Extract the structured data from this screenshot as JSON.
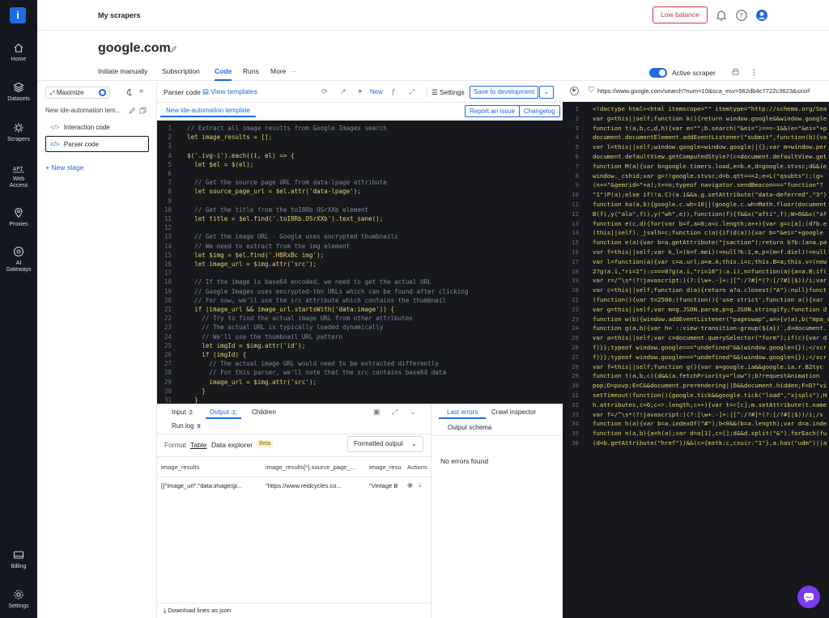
{
  "topbar": {
    "title": "My scrapers",
    "low_balance": "Low balance"
  },
  "nav": [
    {
      "label": "Home",
      "icon": "home-icon"
    },
    {
      "label": "Datasets",
      "icon": "datasets-icon"
    },
    {
      "label": "Scrapers",
      "icon": "scrapers-icon"
    },
    {
      "label": "Web Access",
      "icon": "web-access-icon"
    },
    {
      "label": "Proxies",
      "icon": "proxies-icon"
    },
    {
      "label": "AI Gateways",
      "icon": "ai-gateways-icon"
    },
    {
      "label": "Billing",
      "icon": "billing-icon"
    },
    {
      "label": "Settings",
      "icon": "settings-icon"
    }
  ],
  "header": {
    "site": "google.com",
    "tabs": [
      "Initiate manually",
      "Subscription",
      "Code",
      "Runs",
      "More"
    ],
    "active_tab": "Code",
    "active_scraper": "Active scraper"
  },
  "stages": {
    "maximize": "Maximize",
    "template": "New ide-automation tem...",
    "items": [
      "Interaction code",
      "Parser code"
    ],
    "new_stage": "+ New stage"
  },
  "editor": {
    "label": "Parser code",
    "view_templates": "View templates",
    "new_label": "New",
    "settings": "Settings",
    "save": "Save to development",
    "subtab": "New ide-automation template",
    "report": "Report an issue",
    "changelog": "Changelog",
    "lines": [
      {
        "n": "1",
        "t": "// Extract all image results from Google Images search",
        "c": true
      },
      {
        "n": "2",
        "t": "let image_results = [];",
        "c": false
      },
      {
        "n": "3",
        "t": "",
        "c": false
      },
      {
        "n": "4",
        "t": "$('.ivg-i').each((i, el) => {",
        "c": false
      },
      {
        "n": "5",
        "t": "  let $el = $(el);",
        "c": false
      },
      {
        "n": "6",
        "t": "",
        "c": false
      },
      {
        "n": "7",
        "t": "  // Get the source page URL from data-lpage attribute",
        "c": true
      },
      {
        "n": "8",
        "t": "  let source_page_url = $el.attr('data-lpage');",
        "c": false
      },
      {
        "n": "9",
        "t": "",
        "c": false
      },
      {
        "n": "10",
        "t": "  // Get the title from the toI8Rb OSrXXb element",
        "c": true
      },
      {
        "n": "11",
        "t": "  let title = $el.find('.toI8Rb.OSrXXb').text_sane();",
        "c": false
      },
      {
        "n": "12",
        "t": "",
        "c": false
      },
      {
        "n": "13",
        "t": "  // Get the image URL - Google uses encrypted thumbnails",
        "c": true
      },
      {
        "n": "14",
        "t": "  // We need to extract from the img element",
        "c": true
      },
      {
        "n": "15",
        "t": "  let $img = $el.find('.H8RxBc img');",
        "c": false
      },
      {
        "n": "16",
        "t": "  let image_url = $img.attr('src');",
        "c": false
      },
      {
        "n": "17",
        "t": "",
        "c": false
      },
      {
        "n": "18",
        "t": "  // If the image is base64 encoded, we need to get the actual URL",
        "c": true
      },
      {
        "n": "19",
        "t": "  // Google Images uses encrypted-tbn URLs which can be found after clicking",
        "c": true
      },
      {
        "n": "20",
        "t": "  // For now, we'll use the src attribute which contains the thumbnail",
        "c": true
      },
      {
        "n": "21",
        "t": "  if (image_url && image_url.startsWith('data:image')) {",
        "c": false
      },
      {
        "n": "22",
        "t": "    // Try to find the actual image URL from other attributes",
        "c": true
      },
      {
        "n": "23",
        "t": "    // The actual URL is typically loaded dynamically",
        "c": true
      },
      {
        "n": "24",
        "t": "    // We'll use the thumbnail URL pattern",
        "c": true
      },
      {
        "n": "25",
        "t": "    let imgId = $img.attr('id');",
        "c": false
      },
      {
        "n": "26",
        "t": "    if (imgId) {",
        "c": false
      },
      {
        "n": "27",
        "t": "      // The actual image URL would need to be extracted differently",
        "c": true
      },
      {
        "n": "28",
        "t": "      // For this parser, we'll note that the src contains base64 data",
        "c": true
      },
      {
        "n": "29",
        "t": "      image_url = $img.attr('src');",
        "c": false
      },
      {
        "n": "30",
        "t": "    }",
        "c": false
      },
      {
        "n": "31",
        "t": "  }",
        "c": false
      },
      {
        "n": "32",
        "t": "",
        "c": false
      }
    ]
  },
  "output": {
    "tabs": [
      {
        "label": "Input",
        "count": "2"
      },
      {
        "label": "Output",
        "count": "1"
      },
      {
        "label": "Children",
        "count": ""
      }
    ],
    "run_log": "Run log",
    "run_log_count": "9",
    "formats": [
      "Format",
      "Table",
      "Data explorer"
    ],
    "beta": "Beta",
    "formatted": "Formatted output",
    "columns": [
      "image_results",
      "image_results[*].source_page_...",
      "image_resu",
      "Actions"
    ],
    "row": [
      "[{\"image_url\":\"data:image/gi...",
      "\"https://www.reidcycles.co...",
      "\"Vintage B"
    ],
    "download": "Download lines as json"
  },
  "errors": {
    "tabs": [
      "Last errors",
      "Crawl inspector"
    ],
    "schema": "Output schema",
    "empty": "No errors found"
  },
  "right": {
    "url": "https://www.google.com/search?num=10&sca_esv=562db4c7722c3623&sxsrf",
    "lines": [
      "<!doctype html><html itemscope=\"\" itemtype=\"http://schema.org/Sea",
      "var g=this||self;function k(){return window.google&&window.google",
      "function t(a,b,c,d,h){var e=\"\";b.search(\"&ei=\")===-1&&(e=\"&ei=\"+p",
      "document.documentElement.addEventListener(\"submit\",function(b){va",
      "var l=this||self;window.google=window.google||{};var m=window.per",
      "document.defaultView.getComputedStyle?(c=document.defaultView.get",
      "function M(a){var b=google.timers.load,e=b.e,d=google.stvsc;d&&(e",
      "window._cshid;var g=!!google.stvsc;d=b.qtt===2;e=L(\"qsubts\");(g=",
      "(n+=\"&gemrid=\"+a);t+=n;typeof navigator.sendBeacon===\"function\"?",
      "\"1\")P(a);else if(!a.C)(a.i&&a.g.setAttribute(\"data-deferred\",\"3\")",
      "function ka(a,b){google.c.wh>10||(google.c.wh=Math.floor(document",
      "B(f),y(\"alo\",f)),y(\"wh\",e)),function(f){f&&x(\"afti\",f);W>0&&x(\"af",
      "function e(c,d){for(var b=f,a=0;a<c.length;a++){var g=c[a];(d?b.e",
      "(this||self)._jsalh=c;function c(a){if(d(a)){var b=\"&ei=\"+google",
      "function e(a){var b=a.getAttribute(\"jsaction\");return b?b:(a=a.pa",
      "var f=this||self;var k,l=(k=f.mei)!=null?k:1,m,p=(m=f.diel)!=null",
      "var l=function(a){var c=a.url;a=a.A;this.i=c;this.B=a;this.v=(new",
      "2?g(a.i,\"ri=2\"):c===0?g(a.i,\"ri=16\"):a.i),n=function(a){a=a.B;if(",
      "var r=/^\\s*(?!javascript:)(?:[\\w+.-]+:|[^:/?#]*(?:[/?#]|$))/i;var",
      "var c=this||self;function d(a){return a?a.closest(\"A\"):null}funct",
      "(function(){var t=2500;(function(){'use strict';function a(){var",
      "var g=this||self;var m=g.JSON.parse,p=g.JSON.stringify;function d",
      "function w(b){window.addEventListener(\"pageswap\",a=>{v(a),b(\"mpa_v",
      "function g(a,b){var h=`::view-transition-group(${a})`,d=document.",
      "var a=this||self;var c=document.querySelector(\"form\");if(c){var d",
      "f)}};typeof window.google===\"undefined\"&&(window.google={});</scr",
      "f)}};typeof window.google===\"undefined\"&&(window.google={});</scr",
      "var f=this||self;function g(){var a=google.ia&&google.ia.r.B2tyc",
      "function t(a,b,c){d&&(a.fetchPriority=\"low\");b?requestAnimation",
      "pop;D=povp;E=C&&document.prerendering||D&&document.hidden;F=D?\"vi",
      "setTimeout(function(){google.tick&&google.tick(\"load\",\"xjspls\");H",
      "h.attributes,c=0;c<r.length;c++){var t=r[c];m.setAttribute(t.name",
      "var f=/^\\s*(?!javascript:)(?:[\\w+.-]+:|[^:/?#]*(?:[/?#]|$))/i;/s",
      "function h(a){var b=a.indexOf(\"#\");b<0&&(b=a.length);var d=a.inde",
      "function n(a,b){a=h(a);var d=a[1],c=[];d&&d.split(\"&\").forEach(fu",
      "(d=b.getAttribute(\"href\"))&&(c={mstk:c,csuir:\"1\"},a.has(\"udm\")||a"
    ]
  }
}
